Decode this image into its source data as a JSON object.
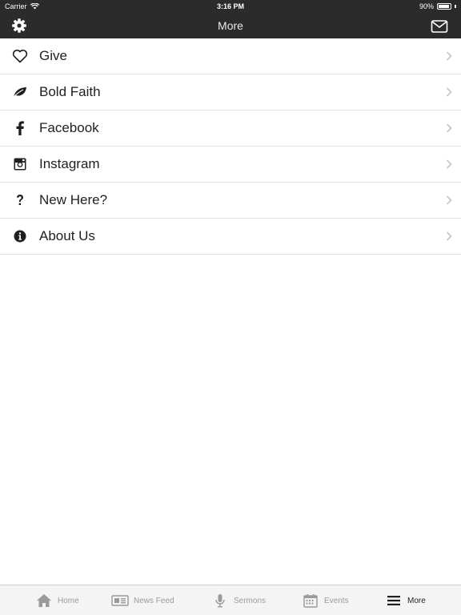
{
  "status_bar": {
    "carrier": "Carrier",
    "time": "3:16 PM",
    "battery": "90%",
    "battery_level": 0.9
  },
  "nav": {
    "title": "More",
    "left_icon": "gear-icon",
    "right_icon": "mail-icon"
  },
  "menu": {
    "items": [
      {
        "label": "Give",
        "icon": "heart-icon"
      },
      {
        "label": "Bold Faith",
        "icon": "leaf-icon"
      },
      {
        "label": "Facebook",
        "icon": "facebook-icon"
      },
      {
        "label": "Instagram",
        "icon": "instagram-icon"
      },
      {
        "label": "New Here?",
        "icon": "question-icon"
      },
      {
        "label": "About Us",
        "icon": "info-icon"
      }
    ]
  },
  "tabs": [
    {
      "label": "Home",
      "icon": "home-icon"
    },
    {
      "label": "News Feed",
      "icon": "newspaper-icon"
    },
    {
      "label": "Sermons",
      "icon": "microphone-icon"
    },
    {
      "label": "Events",
      "icon": "calendar-icon"
    },
    {
      "label": "More",
      "icon": "menu-icon",
      "active": true
    }
  ],
  "colors": {
    "header_bg": "#2b2b2b",
    "tabbar_bg": "#f4f4f4",
    "active_tab": "#1f1f1f",
    "inactive_tab": "#9a9a9a"
  }
}
